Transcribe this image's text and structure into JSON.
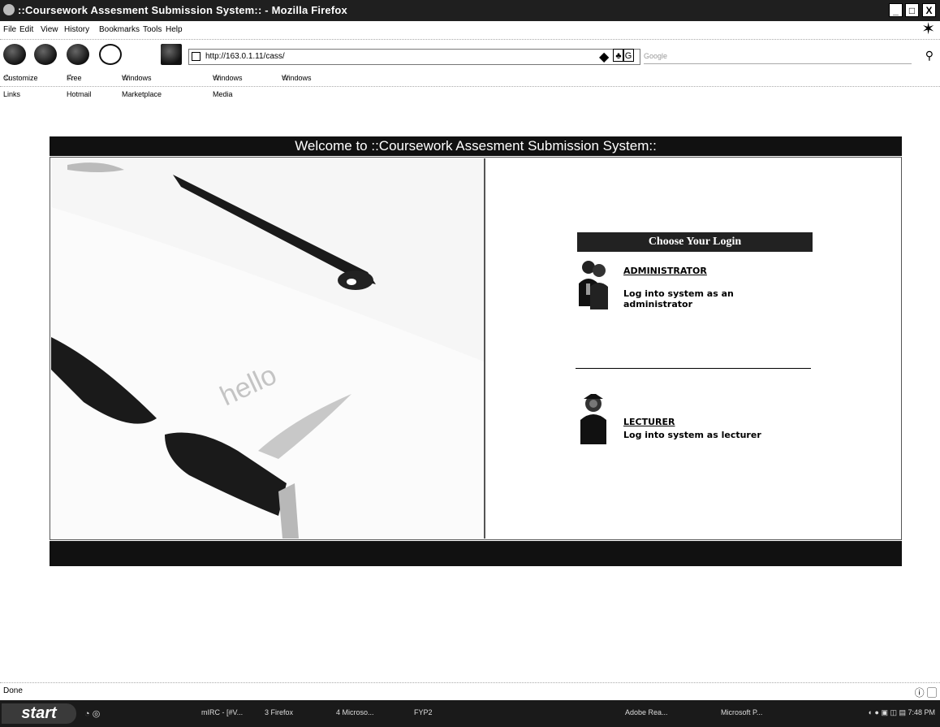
{
  "window": {
    "title": "::Coursework Assesment Submission System:: - Mozilla Firefox",
    "minimize": "_",
    "maximize": "□",
    "close": "X"
  },
  "menu": [
    "File",
    "Edit",
    "View",
    "History",
    "Bookmarks",
    "Tools",
    "Help"
  ],
  "address_bar": {
    "url": "http://163.0.1.11/cass/"
  },
  "search_box": {
    "placeholder": "Google"
  },
  "bookmarks": [
    "Customize Links",
    "Free Hotmail",
    "Windows Marketplace",
    "Windows Media",
    "Windows"
  ],
  "page": {
    "welcome_text": "Welcome to ::Coursework Assesment Submission System::",
    "choose_login": "Choose Your Login",
    "admin": {
      "link": "ADMINISTRATOR",
      "description": "Log into system as an administrator"
    },
    "lecturer": {
      "link": "LECTURER",
      "description": "Log into system as lecturer"
    },
    "image_text": "hello"
  },
  "status": {
    "text": "Done"
  },
  "taskbar": {
    "start": "start",
    "tasks": [
      "mIRC - [#V...",
      "3 Firefox",
      "4 Microso...",
      "FYP2",
      "Adobe Rea...",
      "Microsoft P..."
    ],
    "clock": "7:48 PM"
  }
}
